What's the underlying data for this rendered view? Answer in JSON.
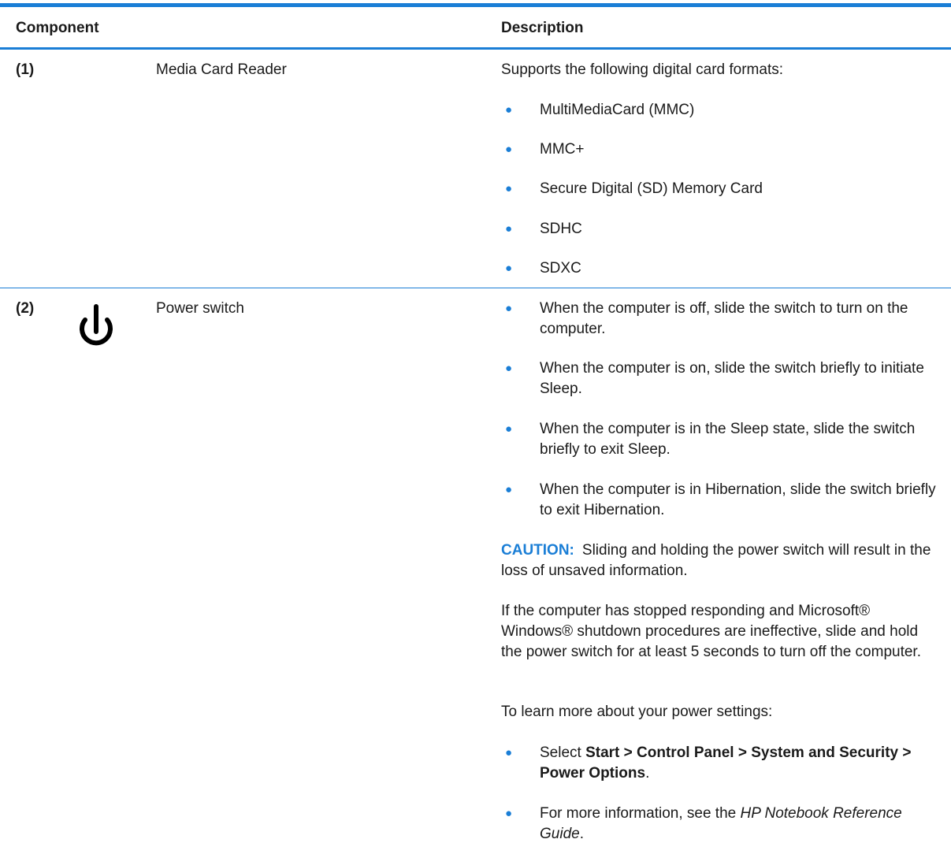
{
  "header": {
    "component": "Component",
    "description": "Description"
  },
  "row1": {
    "number": "(1)",
    "name": "Media Card Reader",
    "intro": "Supports the following digital card formats:",
    "bullets": [
      "MultiMediaCard (MMC)",
      "MMC+",
      "Secure Digital (SD) Memory Card",
      "SDHC",
      "SDXC"
    ]
  },
  "row2": {
    "number": "(2)",
    "icon": "power-icon",
    "name": "Power switch",
    "bullets": [
      "When the computer is off, slide the switch to turn on the computer.",
      "When the computer is on, slide the switch briefly to initiate Sleep.",
      "When the computer is in the Sleep state, slide the switch briefly to exit Sleep.",
      "When the computer is in Hibernation, slide the switch briefly to exit Hibernation."
    ],
    "caution_label": "CAUTION:",
    "caution_text": "Sliding and holding the power switch will result in the loss of unsaved information.",
    "paragraph": "If the computer has stopped responding and Microsoft® Windows® shutdown procedures are ineffective, slide and hold the power switch for at least 5 seconds to turn off the computer.",
    "learn_more": "To learn more about your power settings:",
    "settings_bullet": {
      "prefix": "Select ",
      "path": "Start > Control Panel > System and Security > Power Options",
      "suffix": "."
    },
    "info_bullet": {
      "prefix": "For more information, see the ",
      "guide": "HP Notebook Reference Guide",
      "suffix": "."
    }
  },
  "colors": {
    "accent": "#1a7ed6",
    "text": "#1a1a1a",
    "background": "#ffffff"
  }
}
